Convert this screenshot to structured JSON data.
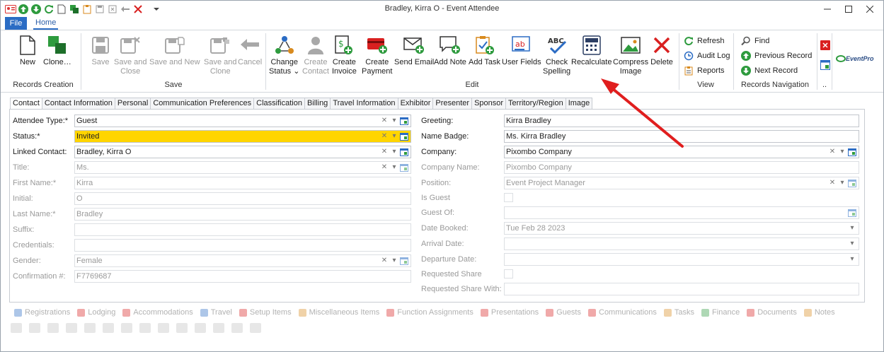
{
  "window": {
    "title": "Bradley, Kirra O - Event Attendee"
  },
  "menu": {
    "file": "File",
    "home": "Home"
  },
  "ribbon": {
    "new": "New",
    "clone": "Clone…",
    "save": "Save",
    "save_close_1": "Save and",
    "save_close_2": "Close",
    "save_new": "Save and New",
    "save_clone_1": "Save and",
    "save_clone_2": "Clone",
    "cancel": "Cancel",
    "change_status_1": "Change",
    "change_status_2": "Status",
    "create_contact_1": "Create",
    "create_contact_2": "Contact",
    "create_invoice_1": "Create",
    "create_invoice_2": "Invoice",
    "create_payment_1": "Create",
    "create_payment_2": "Payment",
    "send_email": "Send Email",
    "add_note": "Add Note",
    "add_task": "Add Task",
    "user_fields": "User Fields",
    "check_spelling_1": "Check",
    "check_spelling_2": "Spelling",
    "recalculate": "Recalculate",
    "compress_image_1": "Compress",
    "compress_image_2": "Image",
    "delete": "Delete",
    "refresh": "Refresh",
    "audit_log": "Audit Log",
    "reports": "Reports",
    "find": "Find",
    "previous_record": "Previous Record",
    "next_record": "Next Record",
    "logo": "EventPro",
    "groups": {
      "records_creation": "Records Creation",
      "save": "Save",
      "edit": "Edit",
      "view": "View",
      "records_navigation": "Records Navigation",
      "more": ".."
    }
  },
  "tabs": [
    "Contact",
    "Contact Information",
    "Personal",
    "Communication Preferences",
    "Classification",
    "Billing",
    "Travel Information",
    "Exhibitor",
    "Presenter",
    "Sponsor",
    "Territory/Region",
    "Image"
  ],
  "contact": {
    "attendee_type": {
      "label": "Attendee Type:*",
      "value": "Guest"
    },
    "status": {
      "label": "Status:*",
      "value": "Invited"
    },
    "linked_contact": {
      "label": "Linked Contact:",
      "value": "Bradley, Kirra O"
    },
    "title": {
      "label": "Title:",
      "value": "Ms."
    },
    "first_name": {
      "label": "First Name:*",
      "value": "Kirra"
    },
    "initial": {
      "label": "Initial:",
      "value": "O"
    },
    "last_name": {
      "label": "Last Name:*",
      "value": "Bradley"
    },
    "suffix": {
      "label": "Suffix:",
      "value": ""
    },
    "credentials": {
      "label": "Credentials:",
      "value": ""
    },
    "gender": {
      "label": "Gender:",
      "value": "Female"
    },
    "confirmation": {
      "label": "Confirmation #:",
      "value": "F7769687"
    },
    "greeting": {
      "label": "Greeting:",
      "value": "Kirra Bradley"
    },
    "name_badge": {
      "label": "Name Badge:",
      "value": "Ms. Kirra Bradley"
    },
    "company": {
      "label": "Company:",
      "value": "Pixombo Company"
    },
    "company_name": {
      "label": "Company Name:",
      "value": "Pixombo Company"
    },
    "position": {
      "label": "Position:",
      "value": "Event Project Manager"
    },
    "is_guest": {
      "label": "Is Guest"
    },
    "guest_of": {
      "label": "Guest Of:",
      "value": ""
    },
    "date_booked": {
      "label": "Date Booked:",
      "value": "Tue Feb 28 2023"
    },
    "arrival_date": {
      "label": "Arrival Date:",
      "value": ""
    },
    "departure_date": {
      "label": "Departure Date:",
      "value": ""
    },
    "requested_share": {
      "label": "Requested Share"
    },
    "requested_share_with": {
      "label": "Requested Share With:",
      "value": ""
    }
  },
  "footer_tabs": [
    "Registrations",
    "Lodging",
    "Accommodations",
    "Travel",
    "Setup Items",
    "Miscellaneous Items",
    "Function Assignments",
    "Presentations",
    "Guests",
    "Communications",
    "Tasks",
    "Finance",
    "Documents",
    "Notes"
  ],
  "colors": {
    "accent": "#2b6cc4",
    "status_highlight": "#ffd500",
    "arrow": "#e01e1e"
  }
}
